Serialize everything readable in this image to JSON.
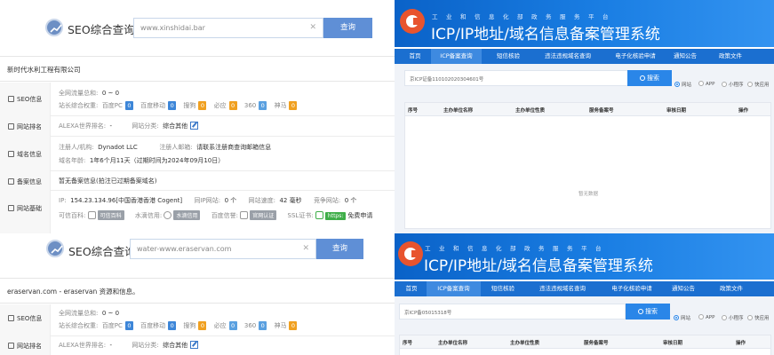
{
  "brand": "SEO综合查询",
  "search_button": "查询",
  "panels": [
    {
      "search_value": "www.xinshidai.bar",
      "site_title": "新时代水利工程有限公司",
      "sidebar": [
        "SEO信息",
        "网站排名",
        "域名信息",
        "备案信息",
        "网站基础"
      ],
      "traffic_label": "全网流量总和:",
      "traffic_value": "0 ~ 0",
      "weight_label": "站长综合权重:",
      "weights": [
        {
          "name": "百度PC",
          "value": "0"
        },
        {
          "name": "百度移动",
          "value": "0"
        },
        {
          "name": "搜狗",
          "value": "0"
        },
        {
          "name": "必应",
          "value": "0"
        },
        {
          "name": "360",
          "value": "0"
        },
        {
          "name": "神马",
          "value": "0"
        }
      ],
      "alexa_label": "ALEXA世界排名:",
      "alexa_value": "-",
      "category_label": "网站分类:",
      "category_value": "综合其他",
      "registrant_label": "注册人/机构:",
      "registrant_value": "Dynadot LLC",
      "email_label": "注册人邮箱:",
      "email_value": "请联系注册商查询邮箱信息",
      "age_label": "域名年龄:",
      "age_value": "1年6个月11天（过期时间为2024年09月10日）",
      "icp_note": "暂无备案信息(拍注已过期备案域名)",
      "ip_label": "IP:",
      "ip_value": "154.23.134.96[中国香港香港 Cogent]",
      "same_ip_label": "同IP网站:",
      "same_ip_value": "0 个",
      "speed_label": "网站速度:",
      "speed_value": "42 毫秒",
      "competitor_label": "竞争网站:",
      "competitor_value": "0 个",
      "trust_label": "可信百科:",
      "trust_tag": "可信百科",
      "shuidi_label": "水滴信用:",
      "shuidi_tag": "水滴信用",
      "baidu_trust_label": "百度信誉:",
      "baidu_trust_tag": "官网认证",
      "ssl_label": "SSL证书:",
      "ssl_tag": "https:",
      "ssl_value": "免费申请"
    },
    {
      "search_value": "water-www.eraservan.com",
      "site_title": "eraservan.com - eraservan 资源和信息。",
      "sidebar": [
        "SEO信息",
        "网站排名"
      ],
      "traffic_label": "全网流量总和:",
      "traffic_value": "0 ~ 0",
      "weight_label": "站长综合权重:",
      "weights": [
        {
          "name": "百度PC",
          "value": "0"
        },
        {
          "name": "百度移动",
          "value": "0"
        },
        {
          "name": "搜狗",
          "value": "0"
        },
        {
          "name": "必应",
          "value": "0"
        },
        {
          "name": "360",
          "value": "0"
        },
        {
          "name": "神马",
          "value": "0"
        }
      ],
      "alexa_label": "ALEXA世界排名:",
      "alexa_value": "-",
      "category_label": "网站分类:",
      "category_value": "综合其他"
    }
  ],
  "icp": {
    "subtitle": "工业和信息化部政务服务平台",
    "title": "ICP/IP地址/域名信息备案管理系统",
    "nav": [
      "首页",
      "ICP备案查询",
      "短信核验",
      "违法违规域名查询",
      "电子化核验申请",
      "通知公告",
      "政策文件"
    ],
    "search_button": "搜索",
    "radios": [
      "网站",
      "APP",
      "小程序",
      "快应用"
    ],
    "columns": [
      "序号",
      "主办单位名称",
      "主办单位性质",
      "服务备案号",
      "审核日期",
      "操作"
    ],
    "no_data": "暂无数据",
    "panels": [
      {
        "input": "京ICP证备110102020304601号"
      },
      {
        "input": "京ICP备05015318号"
      }
    ]
  },
  "colors": {
    "accent": "#5f8fd6",
    "icp_blue": "#1b6fd0",
    "badge_blue": "#3d86d8",
    "badge_orange": "#f0a020"
  }
}
